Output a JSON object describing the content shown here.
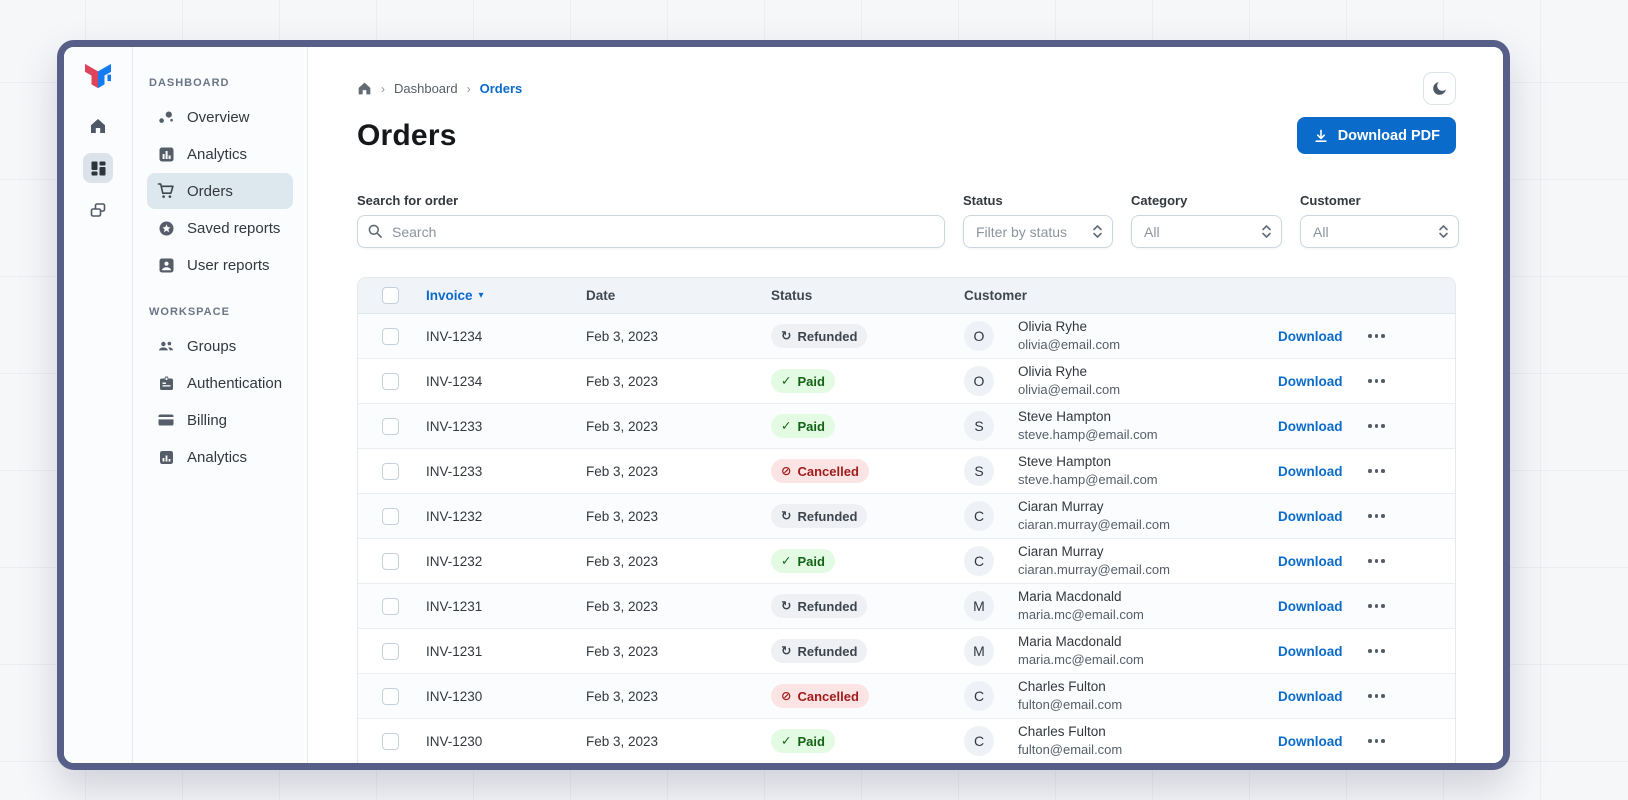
{
  "rail": {
    "logo": "mui-logo",
    "icons": [
      {
        "name": "home-icon",
        "selected": false
      },
      {
        "name": "dashboard-grid-icon",
        "selected": true
      },
      {
        "name": "stacked-pages-icon",
        "selected": false
      }
    ]
  },
  "sidebar": {
    "sections": [
      {
        "title": "DASHBOARD",
        "items": [
          {
            "label": "Overview",
            "icon": "bubbles-icon",
            "selected": false
          },
          {
            "label": "Analytics",
            "icon": "bar-chart-icon",
            "selected": false
          },
          {
            "label": "Orders",
            "icon": "cart-icon",
            "selected": true
          },
          {
            "label": "Saved reports",
            "icon": "star-circle-icon",
            "selected": false
          },
          {
            "label": "User reports",
            "icon": "person-badge-icon",
            "selected": false
          }
        ]
      },
      {
        "title": "WORKSPACE",
        "items": [
          {
            "label": "Groups",
            "icon": "people-icon",
            "selected": false
          },
          {
            "label": "Authentication",
            "icon": "id-badge-icon",
            "selected": false
          },
          {
            "label": "Billing",
            "icon": "credit-card-icon",
            "selected": false
          },
          {
            "label": "Analytics",
            "icon": "analytics-icon",
            "selected": false
          }
        ]
      }
    ]
  },
  "header": {
    "breadcrumb": {
      "home_icon": "home-icon",
      "items": [
        "Dashboard",
        "Orders"
      ]
    },
    "title": "Orders",
    "download_pdf_label": "Download PDF",
    "theme_toggle_icon": "moon-icon"
  },
  "filters": {
    "search": {
      "label": "Search for order",
      "placeholder": "Search",
      "icon": "search-icon"
    },
    "selects": [
      {
        "label": "Status",
        "value": "Filter by status"
      },
      {
        "label": "Category",
        "value": "All"
      },
      {
        "label": "Customer",
        "value": "All"
      }
    ]
  },
  "table": {
    "columns": [
      "Invoice",
      "Date",
      "Status",
      "Customer"
    ],
    "sort_column": "Invoice",
    "download_label": "Download",
    "row_menu_icon": "ellipsis-icon",
    "status_icons": {
      "neutral": "↻",
      "success": "✓",
      "danger": "⊘"
    },
    "rows": [
      {
        "invoice": "INV-1234",
        "date": "Feb 3, 2023",
        "status": "Refunded",
        "status_kind": "neutral",
        "initial": "O",
        "name": "Olivia Ryhe",
        "email": "olivia@email.com"
      },
      {
        "invoice": "INV-1234",
        "date": "Feb 3, 2023",
        "status": "Paid",
        "status_kind": "success",
        "initial": "O",
        "name": "Olivia Ryhe",
        "email": "olivia@email.com"
      },
      {
        "invoice": "INV-1233",
        "date": "Feb 3, 2023",
        "status": "Paid",
        "status_kind": "success",
        "initial": "S",
        "name": "Steve Hampton",
        "email": "steve.hamp@email.com"
      },
      {
        "invoice": "INV-1233",
        "date": "Feb 3, 2023",
        "status": "Cancelled",
        "status_kind": "danger",
        "initial": "S",
        "name": "Steve Hampton",
        "email": "steve.hamp@email.com"
      },
      {
        "invoice": "INV-1232",
        "date": "Feb 3, 2023",
        "status": "Refunded",
        "status_kind": "neutral",
        "initial": "C",
        "name": "Ciaran Murray",
        "email": "ciaran.murray@email.com"
      },
      {
        "invoice": "INV-1232",
        "date": "Feb 3, 2023",
        "status": "Paid",
        "status_kind": "success",
        "initial": "C",
        "name": "Ciaran Murray",
        "email": "ciaran.murray@email.com"
      },
      {
        "invoice": "INV-1231",
        "date": "Feb 3, 2023",
        "status": "Refunded",
        "status_kind": "neutral",
        "initial": "M",
        "name": "Maria Macdonald",
        "email": "maria.mc@email.com"
      },
      {
        "invoice": "INV-1231",
        "date": "Feb 3, 2023",
        "status": "Refunded",
        "status_kind": "neutral",
        "initial": "M",
        "name": "Maria Macdonald",
        "email": "maria.mc@email.com"
      },
      {
        "invoice": "INV-1230",
        "date": "Feb 3, 2023",
        "status": "Cancelled",
        "status_kind": "danger",
        "initial": "C",
        "name": "Charles Fulton",
        "email": "fulton@email.com"
      },
      {
        "invoice": "INV-1230",
        "date": "Feb 3, 2023",
        "status": "Paid",
        "status_kind": "success",
        "initial": "C",
        "name": "Charles Fulton",
        "email": "fulton@email.com"
      }
    ]
  },
  "colors": {
    "primary": "#0b6bcb",
    "window_frame": "#575f88",
    "sidebar_bg": "#fbfcfe",
    "selected_item_bg": "#dde7ee",
    "table_header_bg": "#f0f4f8",
    "chip_paid_bg": "#e3fbe3",
    "chip_paid_text": "#136315",
    "chip_cancelled_bg": "#fce4e4",
    "chip_cancelled_text": "#9f1b1b",
    "chip_refunded_bg": "#eef0f4",
    "chip_refunded_text": "#3c454e"
  }
}
